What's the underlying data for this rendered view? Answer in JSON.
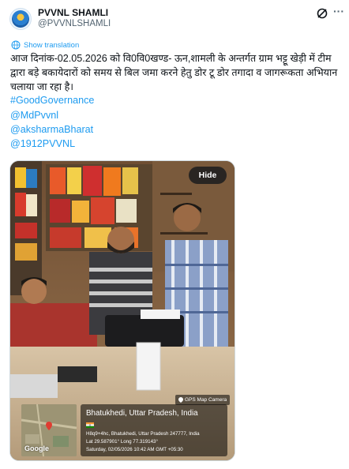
{
  "account": {
    "display_name": "PVVNL SHAMLI",
    "handle": "@PVVNLSHAMLI"
  },
  "translate": {
    "label": "Show translation"
  },
  "tweet": {
    "text": "आज दिनांक-02.05.2026 को वि0वि0खण्ड- ऊन,शामली के अन्तर्गत ग्राम भट्टू खेड़ी में टीम द्वारा बड़े बकायेदारों को समय से बिल जमा करने हेतु डोर टू डोर तगादा व जागरूकता अभियान चलाया जा रहा है।",
    "hashtags": [
      "#GoodGovernance",
      "@MdPvvnl",
      "@aksharmaBharat",
      "@1912PVVNL"
    ]
  },
  "media": {
    "hide_label": "Hide",
    "gps_camera_tag": "GPS Map Camera",
    "location_title": "Bhatukhedi, Uttar Pradesh, India",
    "address_line": "H8q9+4hc, Bhatukhedi, Uttar Pradesh 247777, India",
    "coords_line": "Lat 29.587901° Long 77.319143°",
    "datetime_line": "Saturday, 02/05/2026 10:42 AM GMT +05:30",
    "map_brand": "Google"
  },
  "icons": {
    "grok": "grok-icon",
    "more": "more-icon",
    "translate": "translate-icon",
    "gps": "location-pin-icon"
  },
  "colors": {
    "link": "#1d9bf0",
    "text": "#0f1419",
    "secondary": "#536471"
  }
}
